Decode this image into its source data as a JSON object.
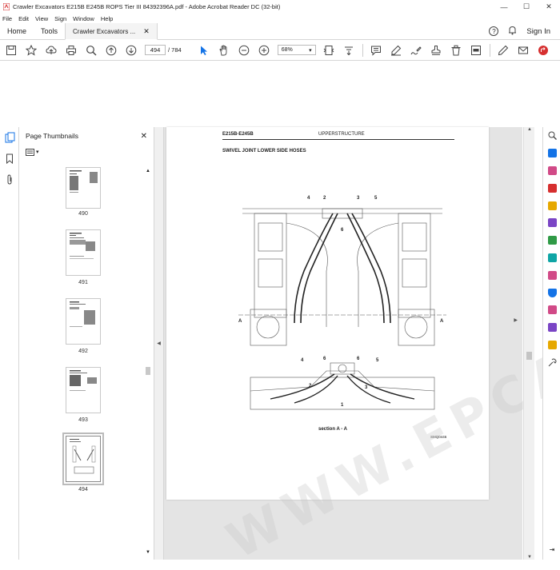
{
  "window": {
    "title": "Crawler Excavators E215B E245B ROPS Tier III 84392396A.pdf - Adobe Acrobat Reader DC (32-bit)",
    "minimize": "—",
    "maximize": "☐",
    "close": "✕"
  },
  "menu": [
    "File",
    "Edit",
    "View",
    "Sign",
    "Window",
    "Help"
  ],
  "tabs": {
    "home": "Home",
    "tools": "Tools",
    "document": "Crawler Excavators ...",
    "sign_in": "Sign In"
  },
  "toolbar": {
    "page_current": "494",
    "page_total": "/ 784",
    "zoom": "68%"
  },
  "thumbnails": {
    "header": "Page Thumbnails",
    "pages": [
      "490",
      "491",
      "492",
      "493",
      "494"
    ],
    "selected": "494"
  },
  "document_page": {
    "model": "E215B-E245B",
    "section": "UPPERSTRUCTURE",
    "heading": "SWIVEL JOINT LOWER SIDE HOSES",
    "callouts_top": [
      "4",
      "2",
      "3",
      "5",
      "6"
    ],
    "callouts_bottom": [
      "4",
      "6",
      "6",
      "5",
      "2",
      "3",
      "1"
    ],
    "section_label": "section  A - A",
    "section_marks": [
      "A",
      "A"
    ],
    "figure_id": "SMQ0446"
  },
  "watermark": "WWW.EPCATALO.COM",
  "colors": {
    "accent": "#1473e6",
    "pdf_red": "#d62f2f",
    "rail_icons": [
      "#1473e6",
      "#2f9a46",
      "#d14a87",
      "#d62f2f",
      "#e6a800",
      "#7a45c5",
      "#2f9a46",
      "#0fa5a5",
      "#d14a87",
      "#1473e6",
      "#d14a87",
      "#7a45c5",
      "#e6a800",
      "#444444"
    ]
  }
}
